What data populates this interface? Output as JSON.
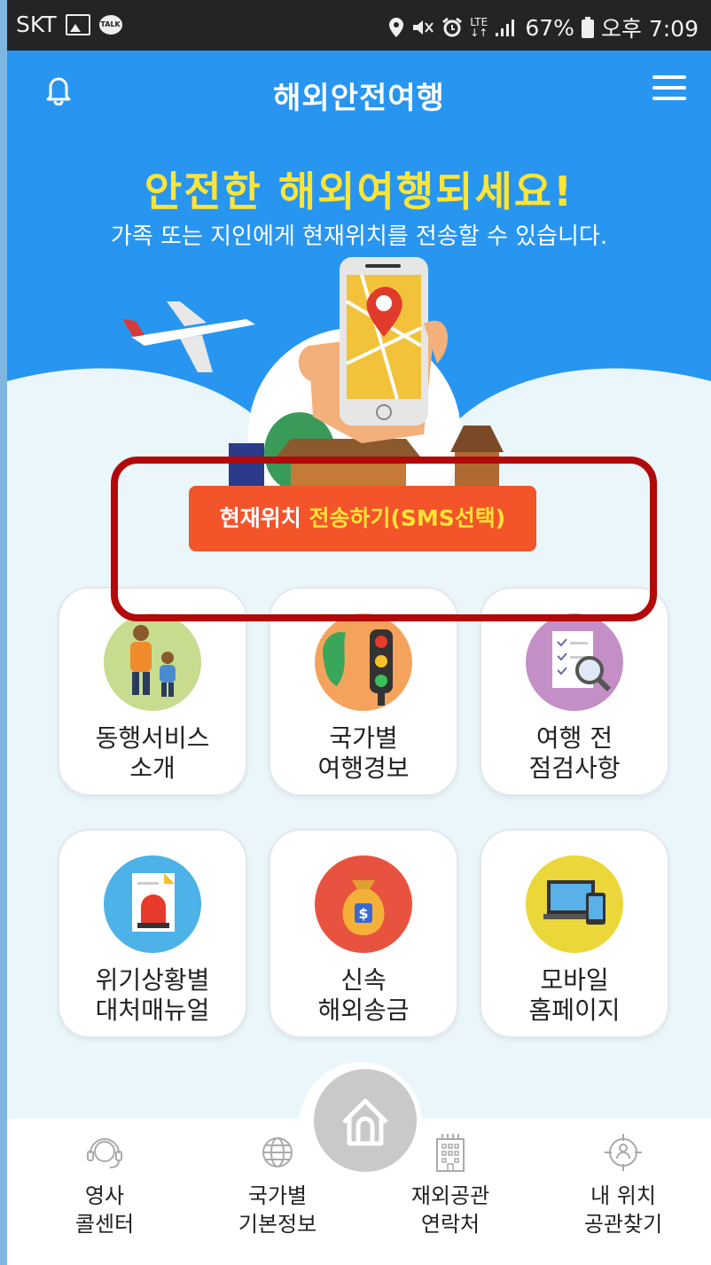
{
  "status_bar": {
    "carrier": "SKT",
    "battery": "67%",
    "time": "오후 7:09",
    "icons": [
      "image-icon",
      "kakaotalk-icon",
      "location-icon",
      "mute-icon",
      "alarm-icon",
      "lte-icon",
      "signal-icon",
      "battery-icon"
    ]
  },
  "header": {
    "title": "해외안전여행",
    "left_icon": "bell-icon",
    "right_icon": "menu-icon"
  },
  "hero": {
    "title": "안전한 해외여행되세요!",
    "subtitle": "가족 또는 지인에게 현재위치를 전송할 수 있습니다.",
    "button_prefix": "현재위치",
    "button_highlight": "전송하기(SMS선택)"
  },
  "tiles": [
    {
      "line1": "동행서비스",
      "line2": "소개",
      "icon": "family-icon",
      "color": "#c7dc8e"
    },
    {
      "line1": "국가별",
      "line2": "여행경보",
      "icon": "traffic-light-icon",
      "color": "#f5a35c"
    },
    {
      "line1": "여행 전",
      "line2": "점검사항",
      "icon": "checklist-icon",
      "color": "#c48fc7"
    },
    {
      "line1": "위기상황별",
      "line2": "대처매뉴얼",
      "icon": "siren-document-icon",
      "color": "#4cb2e8"
    },
    {
      "line1": "신속",
      "line2": "해외송금",
      "icon": "money-bag-icon",
      "color": "#e8533f"
    },
    {
      "line1": "모바일",
      "line2": "홈페이지",
      "icon": "devices-icon",
      "color": "#ecd73a"
    }
  ],
  "bottom_nav": {
    "home_icon": "home-icon",
    "items": [
      {
        "line1": "영사",
        "line2": "콜센터",
        "icon": "headset-icon"
      },
      {
        "line1": "국가별",
        "line2": "기본정보",
        "icon": "globe-icon"
      },
      {
        "line1": "재외공관",
        "line2": "연락처",
        "icon": "building-icon"
      },
      {
        "line1": "내 위치",
        "line2": "공관찾기",
        "icon": "my-location-icon"
      }
    ]
  },
  "colors": {
    "hero_blue": "#2896f0",
    "title_yellow": "#ffe437",
    "button_orange": "#f4542a",
    "highlight_frame": "#b20a0a"
  }
}
